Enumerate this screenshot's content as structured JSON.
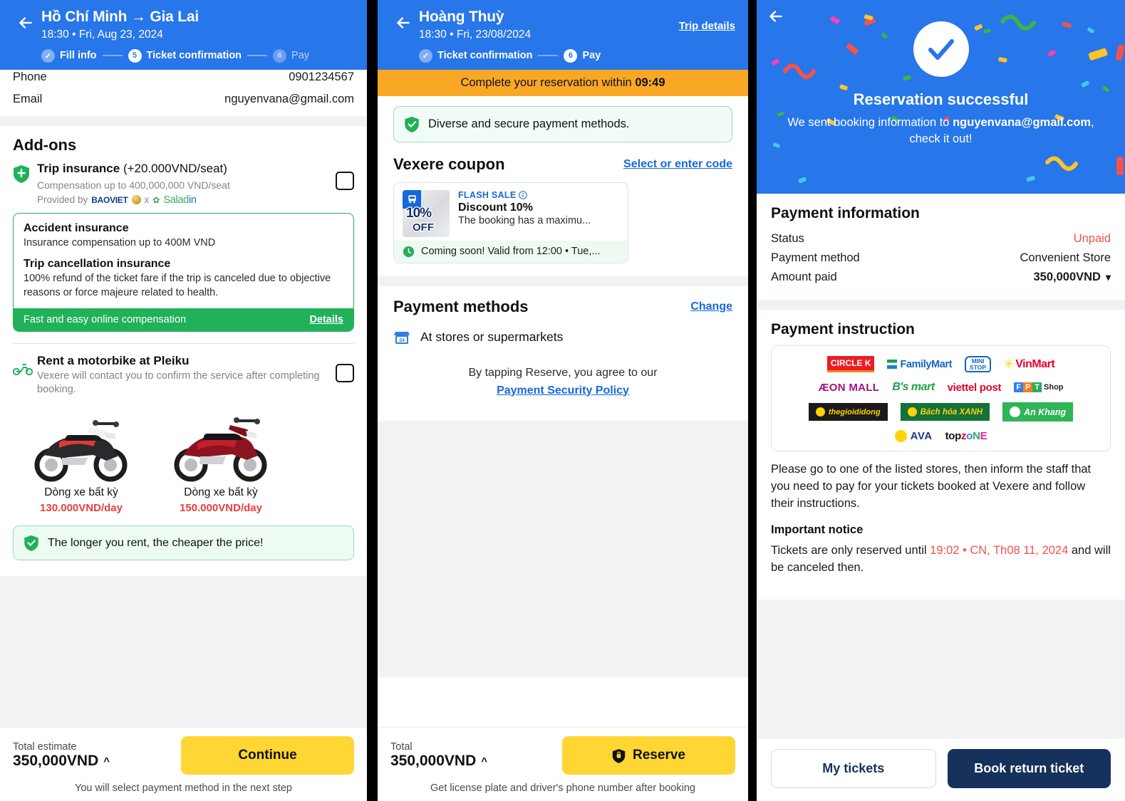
{
  "panel1": {
    "header": {
      "title": "Hồ Chí Minh → Gia Lai",
      "subtitle": "18:30 • Fri, Aug 23, 2024",
      "steps": [
        {
          "num": "✓",
          "label": "Fill info",
          "state": "done"
        },
        {
          "num": "5",
          "label": "Ticket confirmation",
          "state": "active"
        },
        {
          "num": "6",
          "label": "Pay",
          "state": "todo"
        }
      ]
    },
    "info_rows": [
      {
        "label": "Phone",
        "value": "0901234567"
      },
      {
        "label": "Email",
        "value": "nguyenvana@gmail.com"
      }
    ],
    "addons_title": "Add-ons",
    "trip_insurance": {
      "title": "Trip insurance",
      "price": "(+20.000VND/seat)",
      "compensation": "Compensation up to 400,000,000 VND/seat",
      "provided_by": "Provided by",
      "provider_1": "BAOVIET",
      "provider_x": "x",
      "provider_2a": "Salad",
      "provider_2b": "in",
      "box": {
        "h1": "Accident insurance",
        "p1": "Insurance compensation up to 400M VND",
        "h2": "Trip cancellation insurance",
        "p2": "100% refund of the ticket fare if the trip is canceled due to objective reasons or force majeure related to health.",
        "bar_text": "Fast and easy online compensation",
        "bar_link": "Details"
      }
    },
    "motorbike": {
      "title": "Rent a motorbike at Pleiku",
      "subtitle": "Vexere will contact you to confirm the service after completing booking.",
      "items": [
        {
          "name": "Dòng xe bất kỳ",
          "price": "130.000VND/day"
        },
        {
          "name": "Dòng xe bất kỳ",
          "price": "150.000VND/day"
        }
      ],
      "hint": "The longer you rent, the cheaper the price!"
    },
    "footer": {
      "total_label": "Total estimate",
      "total_value": "350,000VND",
      "button": "Continue",
      "note": "You will select payment method in the next step"
    }
  },
  "panel2": {
    "header": {
      "title": "Hoàng Thuỳ",
      "subtitle": "18:30 • Fri, 23/08/2024",
      "trip_details": "Trip details",
      "steps": [
        {
          "num": "✓",
          "label": "Ticket confirmation",
          "state": "done"
        },
        {
          "num": "6",
          "label": "Pay",
          "state": "active"
        }
      ]
    },
    "timer_prefix": "Complete your reservation within",
    "timer_value": "09:49",
    "notice": "Diverse and secure payment methods.",
    "coupon_section": {
      "title": "Vexere coupon",
      "link": "Select or enter code",
      "card": {
        "badge_pct": "10%",
        "badge_off": "OFF",
        "flash": "FLASH SALE",
        "discount": "Discount 10%",
        "desc": "The booking has a maximu...",
        "valid": "Coming soon! Valid from 12:00 • Tue,..."
      }
    },
    "payment_methods": {
      "title": "Payment methods",
      "change": "Change",
      "selected": "At stores or supermarkets",
      "agree_text": "By tapping Reserve, you agree to our",
      "agree_link": "Payment Security Policy"
    },
    "footer": {
      "total_label": "Total",
      "total_value": "350,000VND",
      "button": "Reserve",
      "note": "Get license plate and driver's phone number after booking"
    }
  },
  "panel3": {
    "success": {
      "title": "Reservation successful",
      "msg_pre": "We sent booking information to ",
      "msg_email": "nguyenvana@gmail.com",
      "msg_post": ", check it out!"
    },
    "payment_info": {
      "title": "Payment information",
      "rows": [
        {
          "label": "Status",
          "value": "Unpaid",
          "style": "red"
        },
        {
          "label": "Payment method",
          "value": "Convenient Store",
          "style": "plain"
        },
        {
          "label": "Amount paid",
          "value": "350,000VND",
          "style": "bold-caret"
        }
      ]
    },
    "payment_instruction": {
      "title": "Payment instruction",
      "logos": [
        [
          "CIRCLE K",
          "FamilyMart",
          "MINI STOP",
          "VinMart"
        ],
        [
          "ÆON MALL",
          "B's mart",
          "viettel post",
          "FPT Shop"
        ],
        [
          "thegioididong",
          "Bách hóa XANH",
          "An Khang"
        ],
        [
          "AVA",
          "topzone"
        ]
      ],
      "paragraph": "Please go to one of the listed stores, then inform the staff that you need to pay for your tickets booked at Vexere and follow their instructions.",
      "important_title": "Important notice",
      "notice_pre": "Tickets are only reserved until ",
      "notice_time": "19:02 • CN, Th08 11, 2024",
      "notice_post": " and will be canceled then."
    },
    "footer": {
      "my_tickets": "My tickets",
      "book_return": "Book return ticket"
    }
  },
  "colors": {
    "blue": "#2776ea",
    "yellow": "#ffd633",
    "green": "#20b15a",
    "orange": "#f9a825",
    "red": "#f4524d",
    "navy": "#15315c"
  }
}
